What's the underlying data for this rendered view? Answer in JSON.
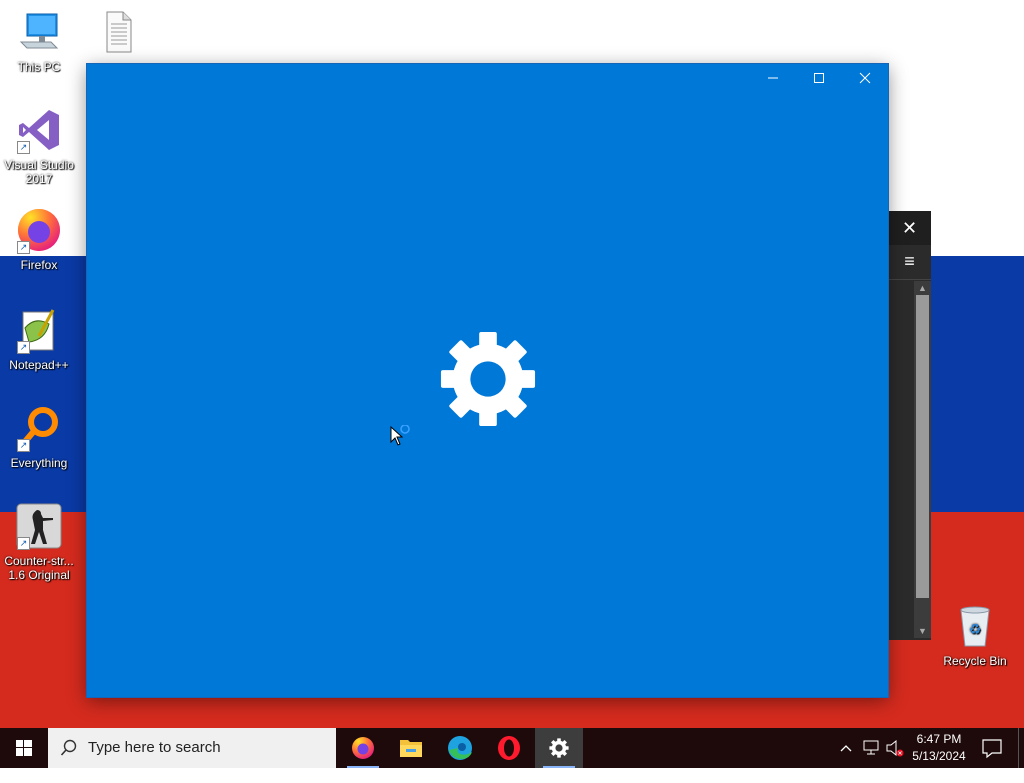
{
  "desktop": {
    "icons": [
      {
        "label": "This PC"
      },
      {
        "label": "Visual Studio 2017"
      },
      {
        "label": "Firefox"
      },
      {
        "label": "Notepad++"
      },
      {
        "label": "Everything"
      },
      {
        "label": "Counter-str... 1.6 Original"
      },
      {
        "label": "Recycle Bin"
      }
    ],
    "wallpaper_colors": [
      "#ffffff",
      "#0a3aa6",
      "#d52b1e"
    ]
  },
  "settings_window": {
    "background": "#0078d7",
    "icon": "gear-icon",
    "state": "loading"
  },
  "taskbar": {
    "search_placeholder": "Type here to search",
    "apps": [
      "firefox-icon",
      "file-explorer-icon",
      "edge-icon",
      "opera-icon",
      "settings-icon"
    ],
    "clock": {
      "time": "6:47 PM",
      "date": "5/13/2024"
    }
  }
}
